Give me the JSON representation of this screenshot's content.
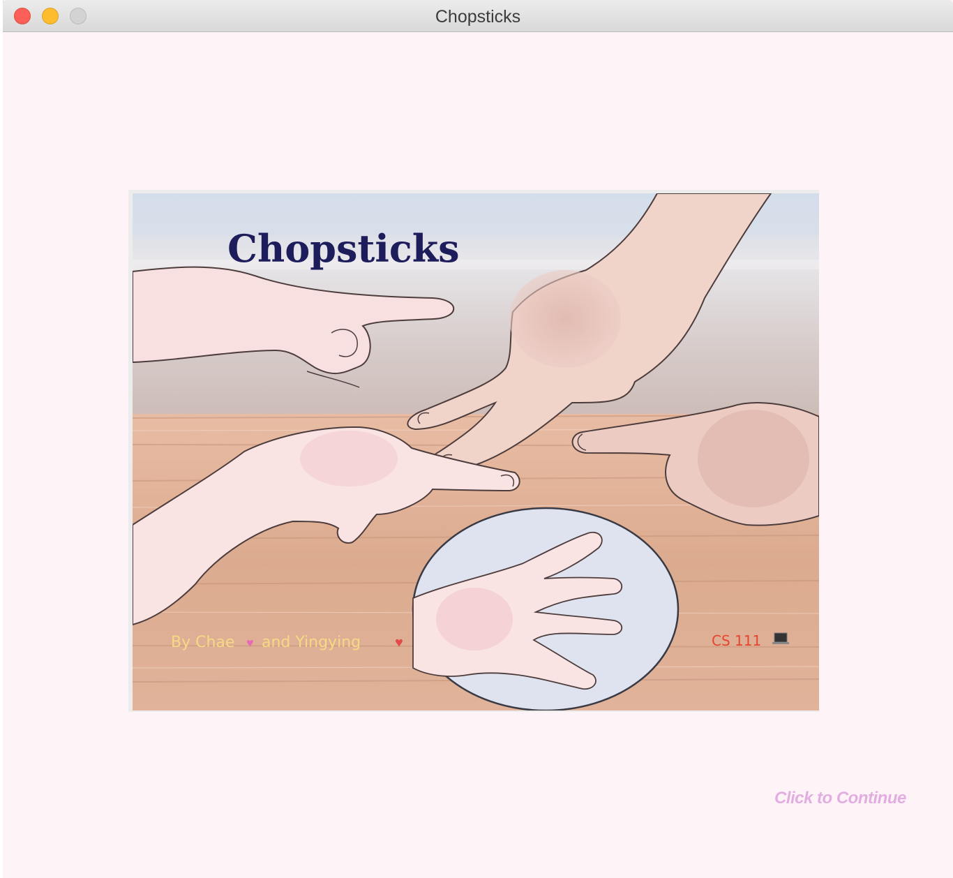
{
  "window": {
    "title": "Chopsticks",
    "controls": [
      "close-icon",
      "minimize-icon",
      "zoom-icon"
    ]
  },
  "cover": {
    "title": "Chopsticks",
    "byline": "By Chae",
    "byline_join": "and Yingying",
    "course": "CS 111",
    "colors": {
      "title": "#1e1d5c",
      "byline": "#f5d987",
      "course": "#e5452f",
      "sky": "#e6ecf3",
      "wall": "#d9cfcb",
      "table": "#d9a98d",
      "skin": "#f7dede",
      "inset_bg": "#dfe2ef"
    }
  },
  "continue_label": "Click to Continue"
}
